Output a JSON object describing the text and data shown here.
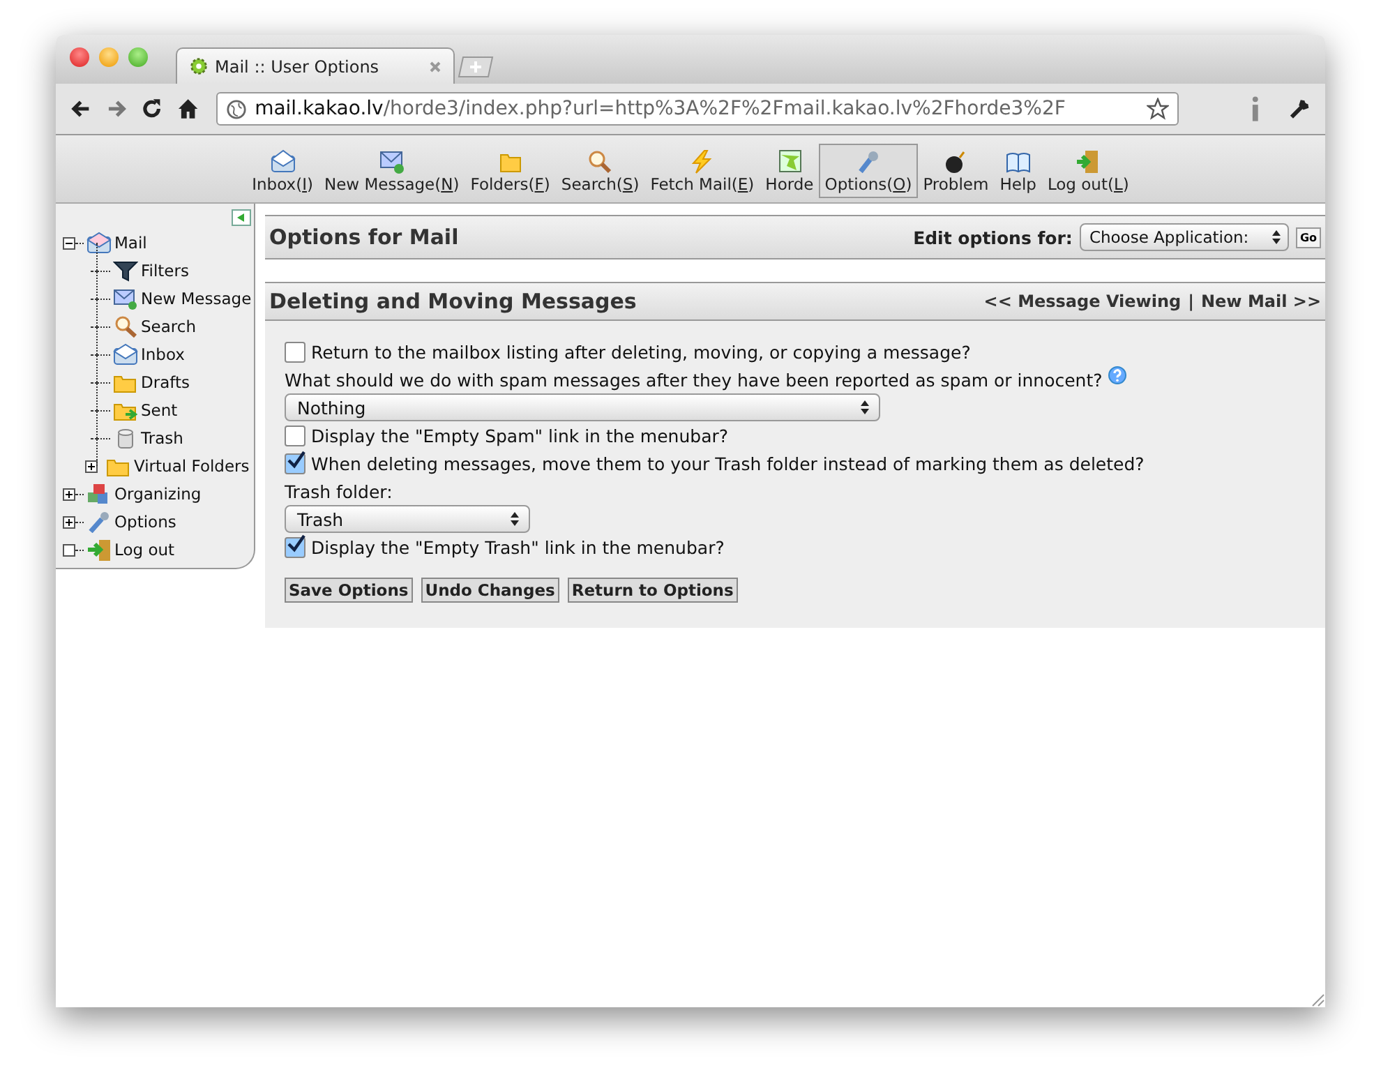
{
  "browser": {
    "tab_title": "Mail :: User Options",
    "url_host": "mail.kakao.lv",
    "url_path": "/horde3/index.php?url=http%3A%2F%2Fmail.kakao.lv%2Fhorde3%2F"
  },
  "toolbar": [
    {
      "before": "Inbox(",
      "key": "I",
      "after": ")",
      "selected": false
    },
    {
      "before": "New Message(",
      "key": "N",
      "after": ")",
      "selected": false
    },
    {
      "before": "Folders(",
      "key": "F",
      "after": ")",
      "selected": false
    },
    {
      "before": "Search(",
      "key": "S",
      "after": ")",
      "selected": false
    },
    {
      "before": "Fetch Mail(",
      "key": "E",
      "after": ")",
      "selected": false
    },
    {
      "before": "Horde",
      "selected": false
    },
    {
      "before": "Options(",
      "key": "O",
      "after": ")",
      "selected": true
    },
    {
      "before": "Problem",
      "selected": false
    },
    {
      "before": "Help",
      "selected": false
    },
    {
      "before": "Log out(",
      "key": "L",
      "after": ")",
      "selected": false
    }
  ],
  "sidebar": {
    "items": [
      {
        "label": "Mail",
        "expandable": true,
        "expanded": true,
        "children": [
          {
            "label": "Filters",
            "expandable": false
          },
          {
            "label": "New Message",
            "expandable": false
          },
          {
            "label": "Search",
            "expandable": false
          },
          {
            "label": "Inbox",
            "expandable": false
          },
          {
            "label": "Drafts",
            "expandable": false
          },
          {
            "label": "Sent",
            "expandable": false
          },
          {
            "label": "Trash",
            "expandable": false
          },
          {
            "label": "Virtual Folders",
            "expandable": true,
            "expanded": false
          }
        ]
      },
      {
        "label": "Organizing",
        "expandable": true,
        "expanded": false
      },
      {
        "label": "Options",
        "expandable": true,
        "expanded": false
      },
      {
        "label": "Log out",
        "expandable": false
      }
    ]
  },
  "header": {
    "title": "Options for Mail",
    "edit_label": "Edit options for:",
    "app_select": "Choose Application:",
    "go": "Go"
  },
  "section": {
    "title": "Deleting and Moving Messages",
    "prev_link": "<< Message Viewing",
    "separator": "|",
    "next_link": "New Mail >>"
  },
  "options": [
    {
      "kind": "checkbox",
      "label": "Return to the mailbox listing after deleting, moving, or copying a message?",
      "checked": false
    },
    {
      "kind": "label",
      "label": "What should we do with spam messages after they have been reported as spam or innocent?",
      "help": true
    },
    {
      "kind": "select",
      "value": "Nothing",
      "wide": true
    },
    {
      "kind": "checkbox",
      "label": "Display the \"Empty Spam\" link in the menubar?",
      "checked": false
    },
    {
      "kind": "checkbox",
      "label": "When deleting messages, move them to your Trash folder instead of marking them as deleted?",
      "checked": true
    },
    {
      "kind": "label",
      "label": "Trash folder:",
      "help": false
    },
    {
      "kind": "select",
      "value": "Trash",
      "wide": false
    },
    {
      "kind": "checkbox",
      "label": "Display the \"Empty Trash\" link in the menubar?",
      "checked": true
    }
  ],
  "buttons": [
    "Save Options",
    "Undo Changes",
    "Return to Options"
  ]
}
